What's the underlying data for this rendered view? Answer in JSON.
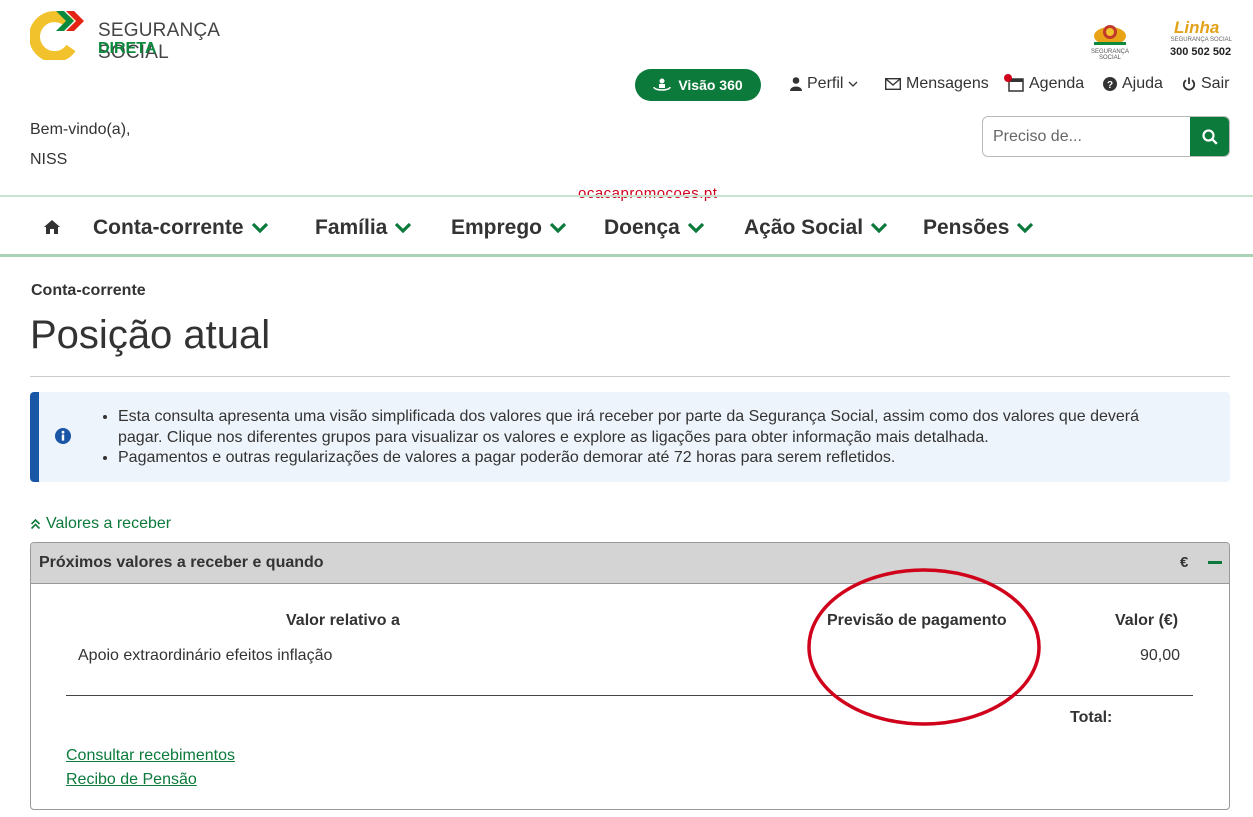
{
  "brand": {
    "name_line1": "SEGURANÇA SOCIAL",
    "name_line2": "DIRETA"
  },
  "partner": {
    "seal_caption": "SEGURANÇA SOCIAL",
    "linha_word": "Linha",
    "linha_sub": "SEGURANÇA SOCIAL",
    "linha_number": "300 502 502"
  },
  "top_nav": {
    "visao_label": "Visão 360",
    "perfil": "Perfil",
    "mensagens": "Mensagens",
    "agenda": "Agenda",
    "ajuda": "Ajuda",
    "sair": "Sair"
  },
  "user": {
    "welcome": "Bem-vindo(a),",
    "niss": "NISS"
  },
  "search": {
    "placeholder": "Preciso de..."
  },
  "watermark": "ocacapromocoes.pt",
  "main_nav": [
    "Conta-corrente",
    "Família",
    "Emprego",
    "Doença",
    "Ação Social",
    "Pensões"
  ],
  "breadcrumb": "Conta-corrente",
  "page_title": "Posição atual",
  "info": {
    "bullet1_line1": "Esta consulta apresenta uma visão simplificada dos valores que irá receber por parte da Segurança Social, assim como dos valores que deverá",
    "bullet1_line2": "pagar. Clique nos diferentes grupos para visualizar os valores e explore as ligações para obter informação mais detalhada.",
    "bullet2": "Pagamentos e outras regularizações de valores a pagar poderão demorar até 72 horas para serem refletidos."
  },
  "section_toggle": "Valores a receber",
  "panel": {
    "title": "Próximos valores a receber e quando",
    "currency": "€",
    "columns": {
      "relative_to": "Valor relativo a",
      "forecast": "Previsão de pagamento",
      "amount": "Valor (€)"
    },
    "rows": [
      {
        "relative_to": "Apoio extraordinário efeitos inflação",
        "forecast": "",
        "amount": "90,00"
      }
    ],
    "total_label": "Total:",
    "links": {
      "consult": "Consultar recebimentos",
      "receipt": "Recibo de Pensão"
    }
  },
  "colors": {
    "brand_green": "#0b7a3b",
    "info_accent": "#1a56a6",
    "annotation_red": "#d0021b"
  }
}
